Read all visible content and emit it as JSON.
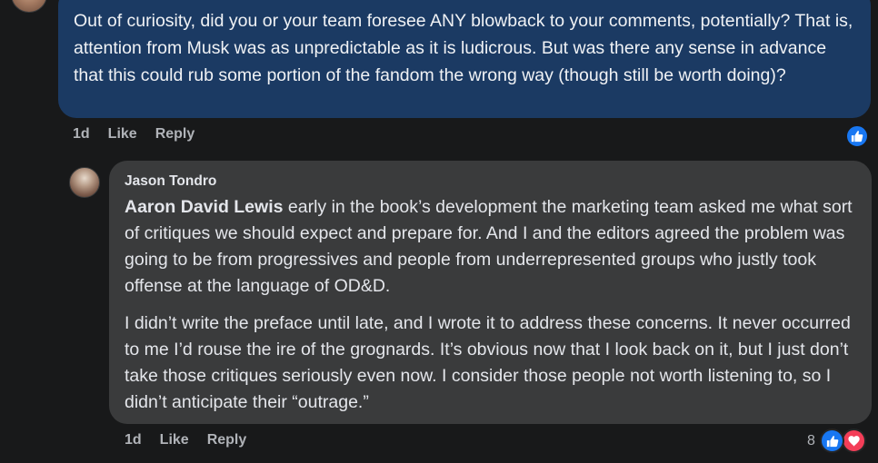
{
  "comment": {
    "text": "Out of curiosity, did you or your team foresee ANY blowback to your comments, potentially? That is, attention from Musk was as unpredictable as it is ludicrous. But was there any sense in advance that this could rub some portion of the fandom the wrong way (though still be worth doing)?",
    "time": "1d",
    "like_label": "Like",
    "reply_label": "Reply",
    "bubble_color": "#1b3a63",
    "reactions": [
      "like-icon"
    ]
  },
  "reply": {
    "author": "Jason Tondro",
    "mention": "Aaron David Lewis",
    "para1_rest": " early in the book’s development the marketing team asked me what sort of critiques we should expect and prepare for. And I and the editors agreed the problem was going to be from progressives and people from underrepresented groups who justly took offense at the language of OD&D.",
    "para2": "I didn’t write the preface until late, and I wrote it to address these concerns. It never occurred to me I’d rouse the ire of the grognards. It’s obvious now that I look back on it, but I just don’t take those critiques seriously even now. I consider those people not worth listening to, so I didn’t anticipate their “outrage.”",
    "time": "1d",
    "like_label": "Like",
    "reply_label": "Reply",
    "reaction_count": "8",
    "reactions": [
      "like-icon",
      "love-icon"
    ],
    "bubble_color": "#3a3b3c"
  },
  "colors": {
    "background": "#18191a",
    "like_blue": "#1877f2",
    "love_red": "#f33e58",
    "meta_text": "#b0b3b8"
  }
}
